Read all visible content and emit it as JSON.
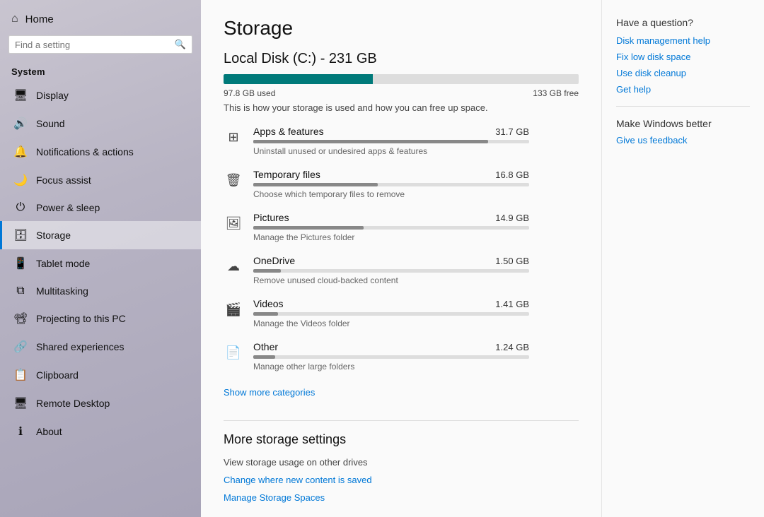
{
  "sidebar": {
    "home_label": "Home",
    "search_placeholder": "Find a setting",
    "section_title": "System",
    "items": [
      {
        "id": "display",
        "label": "Display",
        "icon": "🖥"
      },
      {
        "id": "sound",
        "label": "Sound",
        "icon": "🔊"
      },
      {
        "id": "notifications",
        "label": "Notifications & actions",
        "icon": "🔔"
      },
      {
        "id": "focus",
        "label": "Focus assist",
        "icon": "🌙"
      },
      {
        "id": "power",
        "label": "Power & sleep",
        "icon": "⏻"
      },
      {
        "id": "storage",
        "label": "Storage",
        "icon": "🗄",
        "active": true
      },
      {
        "id": "tablet",
        "label": "Tablet mode",
        "icon": "📱"
      },
      {
        "id": "multitasking",
        "label": "Multitasking",
        "icon": "⧉"
      },
      {
        "id": "projecting",
        "label": "Projecting to this PC",
        "icon": "📽"
      },
      {
        "id": "shared",
        "label": "Shared experiences",
        "icon": "🔗"
      },
      {
        "id": "clipboard",
        "label": "Clipboard",
        "icon": "📋"
      },
      {
        "id": "remote",
        "label": "Remote Desktop",
        "icon": "🖥"
      },
      {
        "id": "about",
        "label": "About",
        "icon": "ℹ"
      }
    ]
  },
  "main": {
    "page_title": "Storage",
    "disk_title": "Local Disk (C:) - 231 GB",
    "used_label": "97.8 GB used",
    "free_label": "133 GB free",
    "bar_percent": 42,
    "description": "This is how your storage is used and how you can free up space.",
    "items": [
      {
        "name": "Apps & features",
        "size": "31.7 GB",
        "desc": "Uninstall unused or undesired apps & features",
        "bar_percent": 85,
        "icon": "apps"
      },
      {
        "name": "Temporary files",
        "size": "16.8 GB",
        "desc": "Choose which temporary files to remove",
        "bar_percent": 45,
        "icon": "temp"
      },
      {
        "name": "Pictures",
        "size": "14.9 GB",
        "desc": "Manage the Pictures folder",
        "bar_percent": 40,
        "icon": "pictures"
      },
      {
        "name": "OneDrive",
        "size": "1.50 GB",
        "desc": "Remove unused cloud-backed content",
        "bar_percent": 10,
        "icon": "onedrive"
      },
      {
        "name": "Videos",
        "size": "1.41 GB",
        "desc": "Manage the Videos folder",
        "bar_percent": 9,
        "icon": "videos"
      },
      {
        "name": "Other",
        "size": "1.24 GB",
        "desc": "Manage other large folders",
        "bar_percent": 8,
        "icon": "other"
      }
    ],
    "show_more_label": "Show more categories",
    "more_settings_title": "More storage settings",
    "more_settings_links": [
      {
        "label": "View storage usage on other drives",
        "clickable": false
      },
      {
        "label": "Change where new content is saved",
        "clickable": true
      },
      {
        "label": "Manage Storage Spaces",
        "clickable": true
      }
    ]
  },
  "right_panel": {
    "question": "Have a question?",
    "links": [
      "Disk management help",
      "Fix low disk space",
      "Use disk cleanup",
      "Get help"
    ],
    "make_better": "Make Windows better",
    "feedback_label": "Give us feedback"
  }
}
